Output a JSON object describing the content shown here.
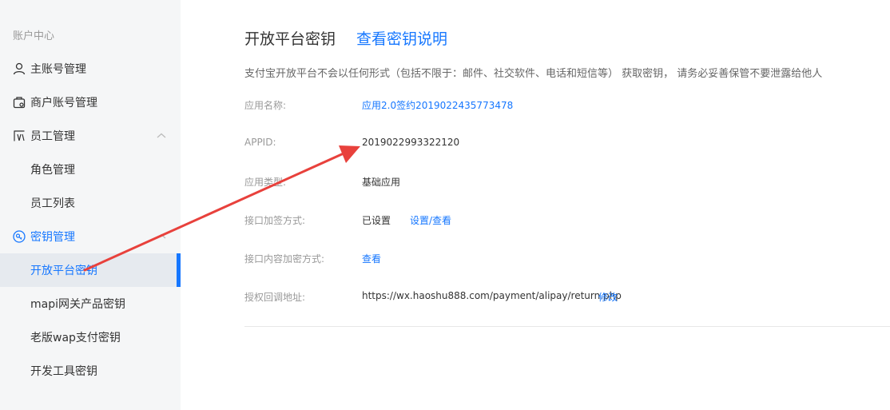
{
  "sidebar": {
    "section_title": "账户中心",
    "items": [
      {
        "label": "主账号管理"
      },
      {
        "label": "商户账号管理"
      },
      {
        "label": "员工管理"
      },
      {
        "label": "角色管理"
      },
      {
        "label": "员工列表"
      },
      {
        "label": "密钥管理"
      },
      {
        "label": "开放平台密钥"
      },
      {
        "label": "mapi网关产品密钥"
      },
      {
        "label": "老版wap支付密钥"
      },
      {
        "label": "开发工具密钥"
      }
    ]
  },
  "main": {
    "title": "开放平台密钥",
    "title_link": "查看密钥说明",
    "notice": "支付宝开放平台不会以任何形式（包括不限于：邮件、社交软件、电话和短信等） 获取密钥， 请务必妥善保管不要泄露给他人",
    "rows": [
      {
        "label": "应用名称:",
        "value": "应用2.0签约2019022435773478"
      },
      {
        "label": "APPID:",
        "value": "2019022993322120"
      },
      {
        "label": "应用类型:",
        "value": "基础应用"
      },
      {
        "label": "接口加签方式:",
        "value": "已设置",
        "link": "设置/查看"
      },
      {
        "label": "接口内容加密方式:",
        "value": "查看"
      },
      {
        "label": "授权回调地址:",
        "value": "https://wx.haoshu888.com/payment/alipay/return.php",
        "link": "修改"
      }
    ]
  },
  "colors": {
    "accent": "#1677ff",
    "sidebar_bg": "#f5f6f7",
    "active_bg": "#e6eaef",
    "annotation_arrow": "#e8413c"
  }
}
